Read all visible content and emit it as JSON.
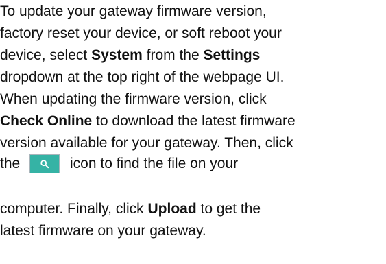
{
  "document": {
    "lines": {
      "l1": "To update your gateway firmware version,",
      "l2": "factory reset your device, or soft reboot your",
      "l3_a": "device, select ",
      "l3_b": "System",
      "l3_c": " from the ",
      "l3_d": "Settings",
      "l4": "dropdown at the top right of the webpage UI.",
      "l5": "When updating the firmware version, click",
      "l6_a": "Check Online",
      "l6_b": " to download the latest firmware",
      "l7": "version available for your gateway. Then, click",
      "l8_a": "the",
      "l8_b": "icon to find the file on your",
      "l9_a": "computer. Finally, click ",
      "l9_b": "Upload",
      "l9_c": " to get the",
      "l10": "latest firmware on your gateway."
    },
    "icon": {
      "name": "search-icon",
      "background": "#35b3a5"
    }
  }
}
